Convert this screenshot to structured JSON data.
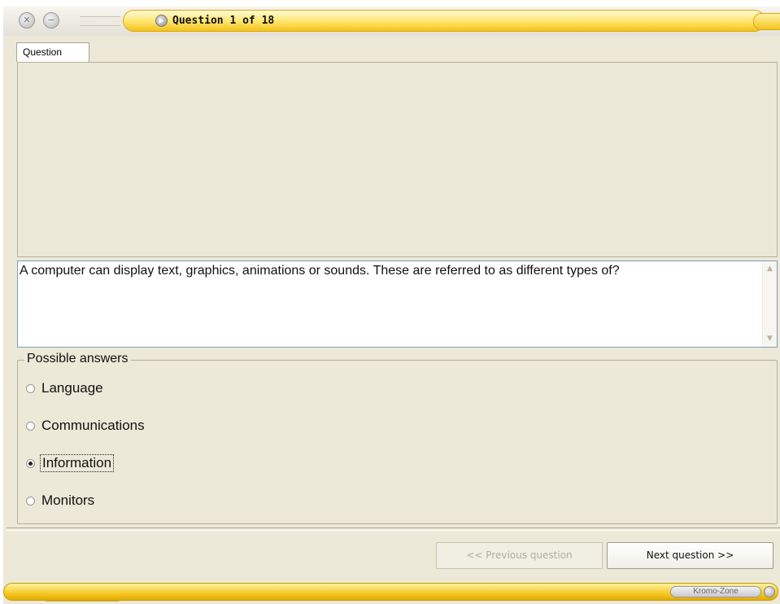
{
  "window": {
    "title": "Question 1 of 18",
    "close_glyph": "✕",
    "minimize_glyph": "−"
  },
  "tabs": [
    {
      "label": "Question"
    }
  ],
  "question": {
    "text": "A computer can display text, graphics, animations or sounds. These are referred to as different types of?"
  },
  "answers": {
    "legend": "Possible answers",
    "options": [
      {
        "label": "Language",
        "selected": false
      },
      {
        "label": "Communications",
        "selected": false
      },
      {
        "label": "Information",
        "selected": true
      },
      {
        "label": "Monitors",
        "selected": false
      }
    ]
  },
  "navigation": {
    "previous_label": "<< Previous question",
    "previous_enabled": false,
    "next_label": "Next question >>"
  },
  "statusbar": {
    "brand": "Kromo-Zone"
  },
  "icons": {
    "close": "close-icon",
    "minimize": "minimize-icon",
    "title": "play-icon",
    "scroll_up": "scroll-up-icon",
    "scroll_down": "scroll-down-icon"
  },
  "colors": {
    "accent_yellow": "#ffe46a",
    "panel": "#ece9d8"
  }
}
